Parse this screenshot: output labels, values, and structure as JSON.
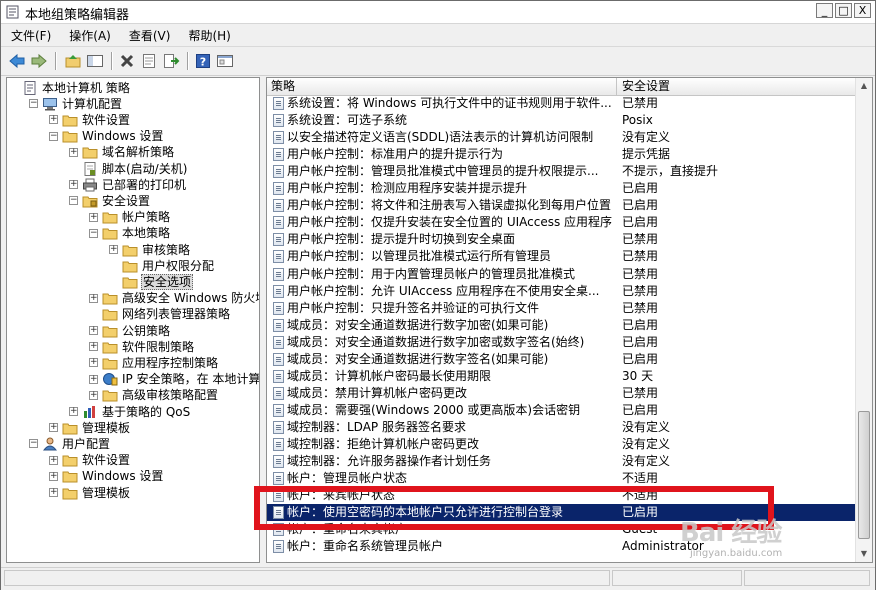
{
  "window": {
    "title": "本地组策略编辑器",
    "buttons": {
      "minimize": "_",
      "maximize": "□",
      "close": "X"
    }
  },
  "menu": [
    {
      "label": "文件(F)"
    },
    {
      "label": "操作(A)"
    },
    {
      "label": "查看(V)"
    },
    {
      "label": "帮助(H)"
    }
  ],
  "toolbar": [
    "back-icon",
    "forward-icon",
    "up-folder-icon",
    "show-hide-tree-icon",
    "delete-icon",
    "properties-icon",
    "export-list-icon",
    "help-icon",
    "console-icon"
  ],
  "tree": [
    {
      "label": "本地计算机 策略",
      "depth": 0,
      "expander": "",
      "icon": "policy"
    },
    {
      "label": "计算机配置",
      "depth": 1,
      "expander": "-",
      "icon": "computer"
    },
    {
      "label": "软件设置",
      "depth": 2,
      "expander": "+",
      "icon": "folder"
    },
    {
      "label": "Windows 设置",
      "depth": 2,
      "expander": "-",
      "icon": "folder"
    },
    {
      "label": "域名解析策略",
      "depth": 3,
      "expander": "+",
      "icon": "folder"
    },
    {
      "label": "脚本(启动/关机)",
      "depth": 3,
      "expander": "",
      "icon": "script"
    },
    {
      "label": "已部署的打印机",
      "depth": 3,
      "expander": "+",
      "icon": "printer"
    },
    {
      "label": "安全设置",
      "depth": 3,
      "expander": "-",
      "icon": "security"
    },
    {
      "label": "帐户策略",
      "depth": 4,
      "expander": "+",
      "icon": "folder"
    },
    {
      "label": "本地策略",
      "depth": 4,
      "expander": "-",
      "icon": "folder"
    },
    {
      "label": "审核策略",
      "depth": 5,
      "expander": "+",
      "icon": "folder"
    },
    {
      "label": "用户权限分配",
      "depth": 5,
      "expander": "",
      "icon": "folder"
    },
    {
      "label": "安全选项",
      "depth": 5,
      "expander": "",
      "icon": "folder",
      "selected": true
    },
    {
      "label": "高级安全 Windows 防火墙",
      "depth": 4,
      "expander": "+",
      "icon": "folder"
    },
    {
      "label": "网络列表管理器策略",
      "depth": 4,
      "expander": "",
      "icon": "folder"
    },
    {
      "label": "公钥策略",
      "depth": 4,
      "expander": "+",
      "icon": "folder"
    },
    {
      "label": "软件限制策略",
      "depth": 4,
      "expander": "+",
      "icon": "folder"
    },
    {
      "label": "应用程序控制策略",
      "depth": 4,
      "expander": "+",
      "icon": "folder"
    },
    {
      "label": "IP 安全策略，在 本地计算机",
      "depth": 4,
      "expander": "+",
      "icon": "ipsec"
    },
    {
      "label": "高级审核策略配置",
      "depth": 4,
      "expander": "+",
      "icon": "folder"
    },
    {
      "label": "基于策略的 QoS",
      "depth": 3,
      "expander": "+",
      "icon": "chart"
    },
    {
      "label": "管理模板",
      "depth": 2,
      "expander": "+",
      "icon": "folder"
    },
    {
      "label": "用户配置",
      "depth": 1,
      "expander": "-",
      "icon": "user"
    },
    {
      "label": "软件设置",
      "depth": 2,
      "expander": "+",
      "icon": "folder"
    },
    {
      "label": "Windows 设置",
      "depth": 2,
      "expander": "+",
      "icon": "folder"
    },
    {
      "label": "管理模板",
      "depth": 2,
      "expander": "+",
      "icon": "folder"
    }
  ],
  "list": {
    "columns": [
      "策略",
      "安全设置"
    ],
    "rows": [
      {
        "policy": "系统设置：将 Windows 可执行文件中的证书规则用于软件...",
        "setting": "已禁用"
      },
      {
        "policy": "系统设置：可选子系统",
        "setting": "Posix"
      },
      {
        "policy": "以安全描述符定义语言(SDDL)语法表示的计算机访问限制",
        "setting": "没有定义"
      },
      {
        "policy": "用户帐户控制：标准用户的提升提示行为",
        "setting": "提示凭据"
      },
      {
        "policy": "用户帐户控制：管理员批准模式中管理员的提升权限提示...",
        "setting": "不提示，直接提升"
      },
      {
        "policy": "用户帐户控制：检测应用程序安装并提示提升",
        "setting": "已启用"
      },
      {
        "policy": "用户帐户控制：将文件和注册表写入错误虚拟化到每用户位置",
        "setting": "已启用"
      },
      {
        "policy": "用户帐户控制：仅提升安装在安全位置的 UIAccess 应用程序",
        "setting": "已启用"
      },
      {
        "policy": "用户帐户控制：提示提升时切换到安全桌面",
        "setting": "已禁用"
      },
      {
        "policy": "用户帐户控制：以管理员批准模式运行所有管理员",
        "setting": "已禁用"
      },
      {
        "policy": "用户帐户控制：用于内置管理员帐户的管理员批准模式",
        "setting": "已禁用"
      },
      {
        "policy": "用户帐户控制：允许 UIAccess 应用程序在不使用安全桌...",
        "setting": "已禁用"
      },
      {
        "policy": "用户帐户控制：只提升签名并验证的可执行文件",
        "setting": "已禁用"
      },
      {
        "policy": "域成员：对安全通道数据进行数字加密(如果可能)",
        "setting": "已启用"
      },
      {
        "policy": "域成员：对安全通道数据进行数字加密或数字签名(始终)",
        "setting": "已启用"
      },
      {
        "policy": "域成员：对安全通道数据进行数字签名(如果可能)",
        "setting": "已启用"
      },
      {
        "policy": "域成员：计算机帐户密码最长使用期限",
        "setting": "30 天"
      },
      {
        "policy": "域成员：禁用计算机帐户密码更改",
        "setting": "已禁用"
      },
      {
        "policy": "域成员：需要强(Windows 2000 或更高版本)会话密钥",
        "setting": "已启用"
      },
      {
        "policy": "域控制器：LDAP 服务器签名要求",
        "setting": "没有定义"
      },
      {
        "policy": "域控制器：拒绝计算机帐户密码更改",
        "setting": "没有定义"
      },
      {
        "policy": "域控制器：允许服务器操作者计划任务",
        "setting": "没有定义"
      },
      {
        "policy": "帐户：管理员帐户状态",
        "setting": "不适用"
      },
      {
        "policy": "帐户：来宾帐户状态",
        "setting": "不适用"
      },
      {
        "policy": "帐户：使用空密码的本地帐户只允许进行控制台登录",
        "setting": "已启用",
        "selected": true
      },
      {
        "policy": "帐户：重命名来宾帐户",
        "setting": "Guest"
      },
      {
        "policy": "帐户：重命名系统管理员帐户",
        "setting": "Administrator"
      }
    ]
  },
  "watermark": {
    "brand": "Bai 经验",
    "url": "jingyan.baidu.com"
  },
  "highlight_color": "#e0141c"
}
